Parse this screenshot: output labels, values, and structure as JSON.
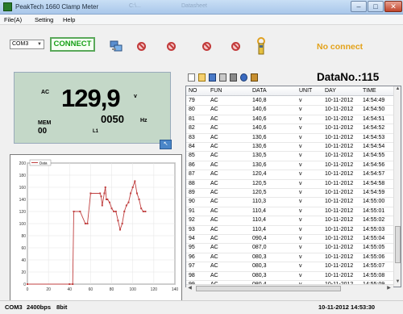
{
  "window": {
    "title": "PeakTech 1660 Clamp Meter",
    "ghost_text_1": "C:\\...",
    "ghost_text_2": "Datasheet",
    "min_label": "–",
    "max_label": "□",
    "close_label": "✕"
  },
  "menu": [
    "File(A)",
    "Setting",
    "Help"
  ],
  "toolbar": {
    "port_value": "COM3",
    "connect_label": "CONNECT",
    "status_text": "No connect",
    "icons": [
      "computer-network-icon",
      "no-icon",
      "no-icon",
      "no-icon",
      "no-icon",
      "clamp-meter-icon"
    ]
  },
  "display": {
    "mode": "AC",
    "value": "129,9",
    "unit": "v",
    "mem_label": "MEM",
    "mem_value": "00",
    "freq_value": "0050",
    "freq_unit": "Hz",
    "line": "L1"
  },
  "chart_data": {
    "type": "line",
    "series": [
      {
        "name": "Data",
        "color": "#c04040"
      }
    ],
    "x": [
      0,
      40,
      43,
      44,
      50,
      55,
      57,
      60,
      69,
      70,
      71,
      73,
      74,
      75,
      76,
      78,
      80,
      82,
      84,
      86,
      88,
      90,
      92,
      94,
      96,
      98,
      100,
      102,
      104,
      106,
      108,
      110,
      112
    ],
    "y": [
      0,
      0,
      0,
      120,
      120,
      100,
      100,
      150,
      150,
      145,
      130,
      150,
      160,
      140,
      140,
      135,
      125,
      120,
      120,
      105,
      90,
      100,
      120,
      130,
      135,
      150,
      160,
      170,
      150,
      140,
      125,
      120,
      120
    ],
    "xlim": [
      0,
      140
    ],
    "ylim": [
      0,
      200
    ],
    "xticks": [
      "0",
      "20",
      "40",
      "60",
      "80",
      "100",
      "120",
      "140"
    ],
    "yticks": [
      "0",
      "20",
      "40",
      "60",
      "80",
      "100",
      "120",
      "140",
      "160",
      "180",
      "200"
    ],
    "legend": "Data",
    "grid": true
  },
  "grid_toolbar_icons": [
    "new-icon",
    "open-icon",
    "save-icon",
    "print-icon",
    "settings-icon",
    "help-icon",
    "clear-icon"
  ],
  "datano": "DataNo.:115",
  "table": {
    "columns": [
      "NO",
      "FUN",
      "DATA",
      "UNIT",
      "DAY",
      "TIME"
    ],
    "rows": [
      [
        "79",
        "AC",
        "140,8",
        "v",
        "10-11-2012",
        "14:54:49"
      ],
      [
        "80",
        "AC",
        "140,6",
        "v",
        "10-11-2012",
        "14:54:50"
      ],
      [
        "81",
        "AC",
        "140,6",
        "v",
        "10-11-2012",
        "14:54:51"
      ],
      [
        "82",
        "AC",
        "140,6",
        "v",
        "10-11-2012",
        "14:54:52"
      ],
      [
        "83",
        "AC",
        "130,6",
        "v",
        "10-11-2012",
        "14:54:53"
      ],
      [
        "84",
        "AC",
        "130,6",
        "v",
        "10-11-2012",
        "14:54:54"
      ],
      [
        "85",
        "AC",
        "130,5",
        "v",
        "10-11-2012",
        "14:54:55"
      ],
      [
        "86",
        "AC",
        "130,6",
        "v",
        "10-11-2012",
        "14:54:56"
      ],
      [
        "87",
        "AC",
        "120,4",
        "v",
        "10-11-2012",
        "14:54:57"
      ],
      [
        "88",
        "AC",
        "120,5",
        "v",
        "10-11-2012",
        "14:54:58"
      ],
      [
        "89",
        "AC",
        "120,5",
        "v",
        "10-11-2012",
        "14:54:59"
      ],
      [
        "90",
        "AC",
        "110,3",
        "v",
        "10-11-2012",
        "14:55:00"
      ],
      [
        "91",
        "AC",
        "110,4",
        "v",
        "10-11-2012",
        "14:55:01"
      ],
      [
        "92",
        "AC",
        "110,4",
        "v",
        "10-11-2012",
        "14:55:02"
      ],
      [
        "93",
        "AC",
        "110,4",
        "v",
        "10-11-2012",
        "14:55:03"
      ],
      [
        "94",
        "AC",
        "090,4",
        "v",
        "10-11-2012",
        "14:55:04"
      ],
      [
        "95",
        "AC",
        "087,0",
        "v",
        "10-11-2012",
        "14:55:05"
      ],
      [
        "96",
        "AC",
        "080,3",
        "v",
        "10-11-2012",
        "14:55:06"
      ],
      [
        "97",
        "AC",
        "080,3",
        "v",
        "10-11-2012",
        "14:55:07"
      ],
      [
        "98",
        "AC",
        "080,3",
        "v",
        "10-11-2012",
        "14:55:08"
      ],
      [
        "99",
        "AC",
        "080,4",
        "v",
        "10-11-2012",
        "14:55:09"
      ]
    ]
  },
  "statusbar": {
    "port": "COM3",
    "baud": "2400bps",
    "bits": "8bit",
    "datetime": "10-11-2012 14:53:30"
  }
}
